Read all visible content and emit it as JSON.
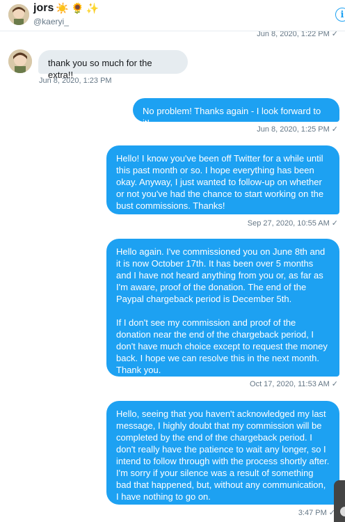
{
  "header": {
    "name": "jors",
    "emojis": [
      "☀️",
      "🌻",
      "✨"
    ],
    "handle": "@kaeryi_",
    "info_icon": "i"
  },
  "messages": [
    {
      "direction": "out",
      "text": "",
      "time": "Jun 8, 2020, 1:22 PM",
      "read": "✓"
    },
    {
      "direction": "in",
      "text": "thank you so much for the extra!!",
      "time": "Jun 8, 2020, 1:23 PM"
    },
    {
      "direction": "out",
      "text": "No problem! Thanks again - I look forward to it!",
      "time": "Jun 8, 2020, 1:25 PM",
      "read": "✓"
    },
    {
      "direction": "out",
      "text": "Hello! I know you've been off Twitter for a while until this past month or so. I hope everything has been okay. Anyway, I just wanted to follow-up on whether or not you've had the chance to start working on the bust commissions. Thanks!",
      "time": "Sep 27, 2020, 10:55 AM",
      "read": "✓"
    },
    {
      "direction": "out",
      "text": "Hello again. I've commissioned you on June 8th and it is now October 17th. It has been over 5 months and I have not heard anything from you or, as far as I'm aware, proof of the donation. The end of the Paypal chargeback period is December 5th.\n\nIf I don't see my commission and proof of the donation near the end of the chargeback period, I don't have much choice except to request the money back. I hope we can resolve this in the next month. Thank you.",
      "time": "Oct 17, 2020, 11:53 AM",
      "read": "✓"
    },
    {
      "direction": "out",
      "text": "Hello, seeing that you haven't acknowledged my last message, I highly doubt that my commission will be completed by the end of the chargeback period. I don't really have the patience to wait any longer, so I intend to follow through with the process shortly after. I'm sorry if your silence was a result of something bad that happened, but, without any communication, I have nothing to go on.",
      "time": "3:47 PM",
      "read": "✓"
    }
  ],
  "colors": {
    "accent": "#1da1f2",
    "bubble_in": "#e6ecf0",
    "muted": "#657786"
  }
}
